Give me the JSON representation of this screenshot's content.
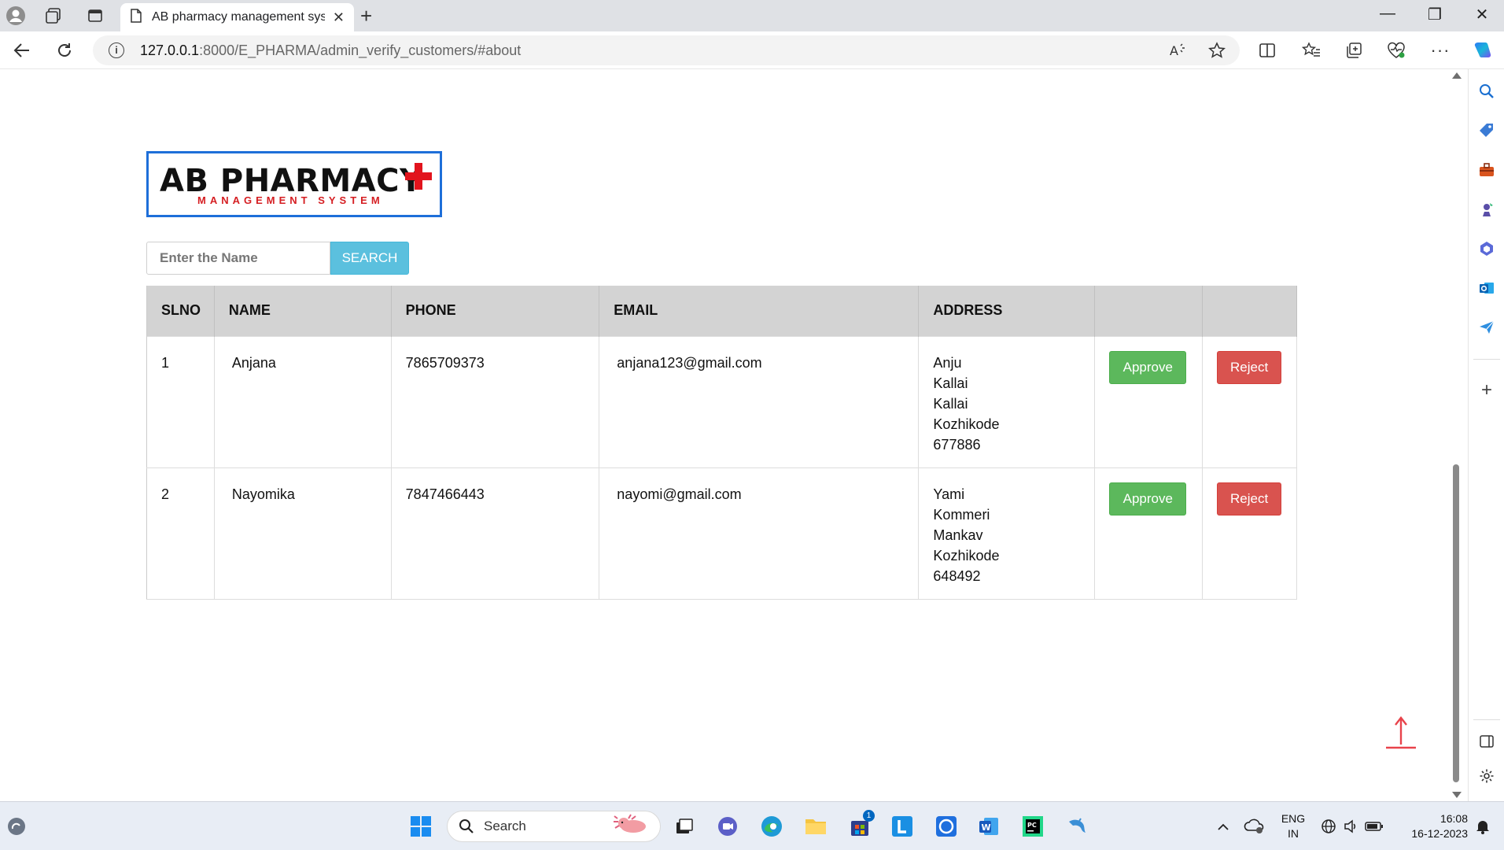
{
  "browser": {
    "tab_title": "AB pharmacy management syste",
    "url_host": "127.0.0.1",
    "url_path": ":8000/E_PHARMA/admin_verify_customers/#about"
  },
  "logo": {
    "main_text": "AB PHARMACY",
    "sub_text": "MANAGEMENT SYSTEM"
  },
  "search": {
    "placeholder": "Enter the Name",
    "button_label": "SEARCH"
  },
  "table": {
    "headers": [
      "SLNO",
      "NAME",
      "PHONE",
      "EMAIL",
      "ADDRESS",
      "",
      ""
    ],
    "rows": [
      {
        "slno": "1",
        "name": "Anjana",
        "phone": "7865709373",
        "email": "anjana123@gmail.com",
        "address": [
          "Anju",
          "Kallai",
          "Kallai",
          "Kozhikode",
          "677886"
        ],
        "approve_label": "Approve",
        "reject_label": "Reject"
      },
      {
        "slno": "2",
        "name": "Nayomika",
        "phone": "7847466443",
        "email": "nayomi@gmail.com",
        "address": [
          "Yami",
          "Kommeri",
          "Mankav",
          "Kozhikode",
          "648492"
        ],
        "approve_label": "Approve",
        "reject_label": "Reject"
      }
    ]
  },
  "taskbar": {
    "search_label": "Search",
    "store_badge": "1",
    "lang_top": "ENG",
    "lang_bottom": "IN",
    "time": "16:08",
    "date": "16-12-2023"
  },
  "colors": {
    "search_button": "#5bc0de",
    "approve": "#5cb85c",
    "reject": "#d9534f",
    "logo_border": "#1e6fd9",
    "logo_red": "#e2141d"
  }
}
